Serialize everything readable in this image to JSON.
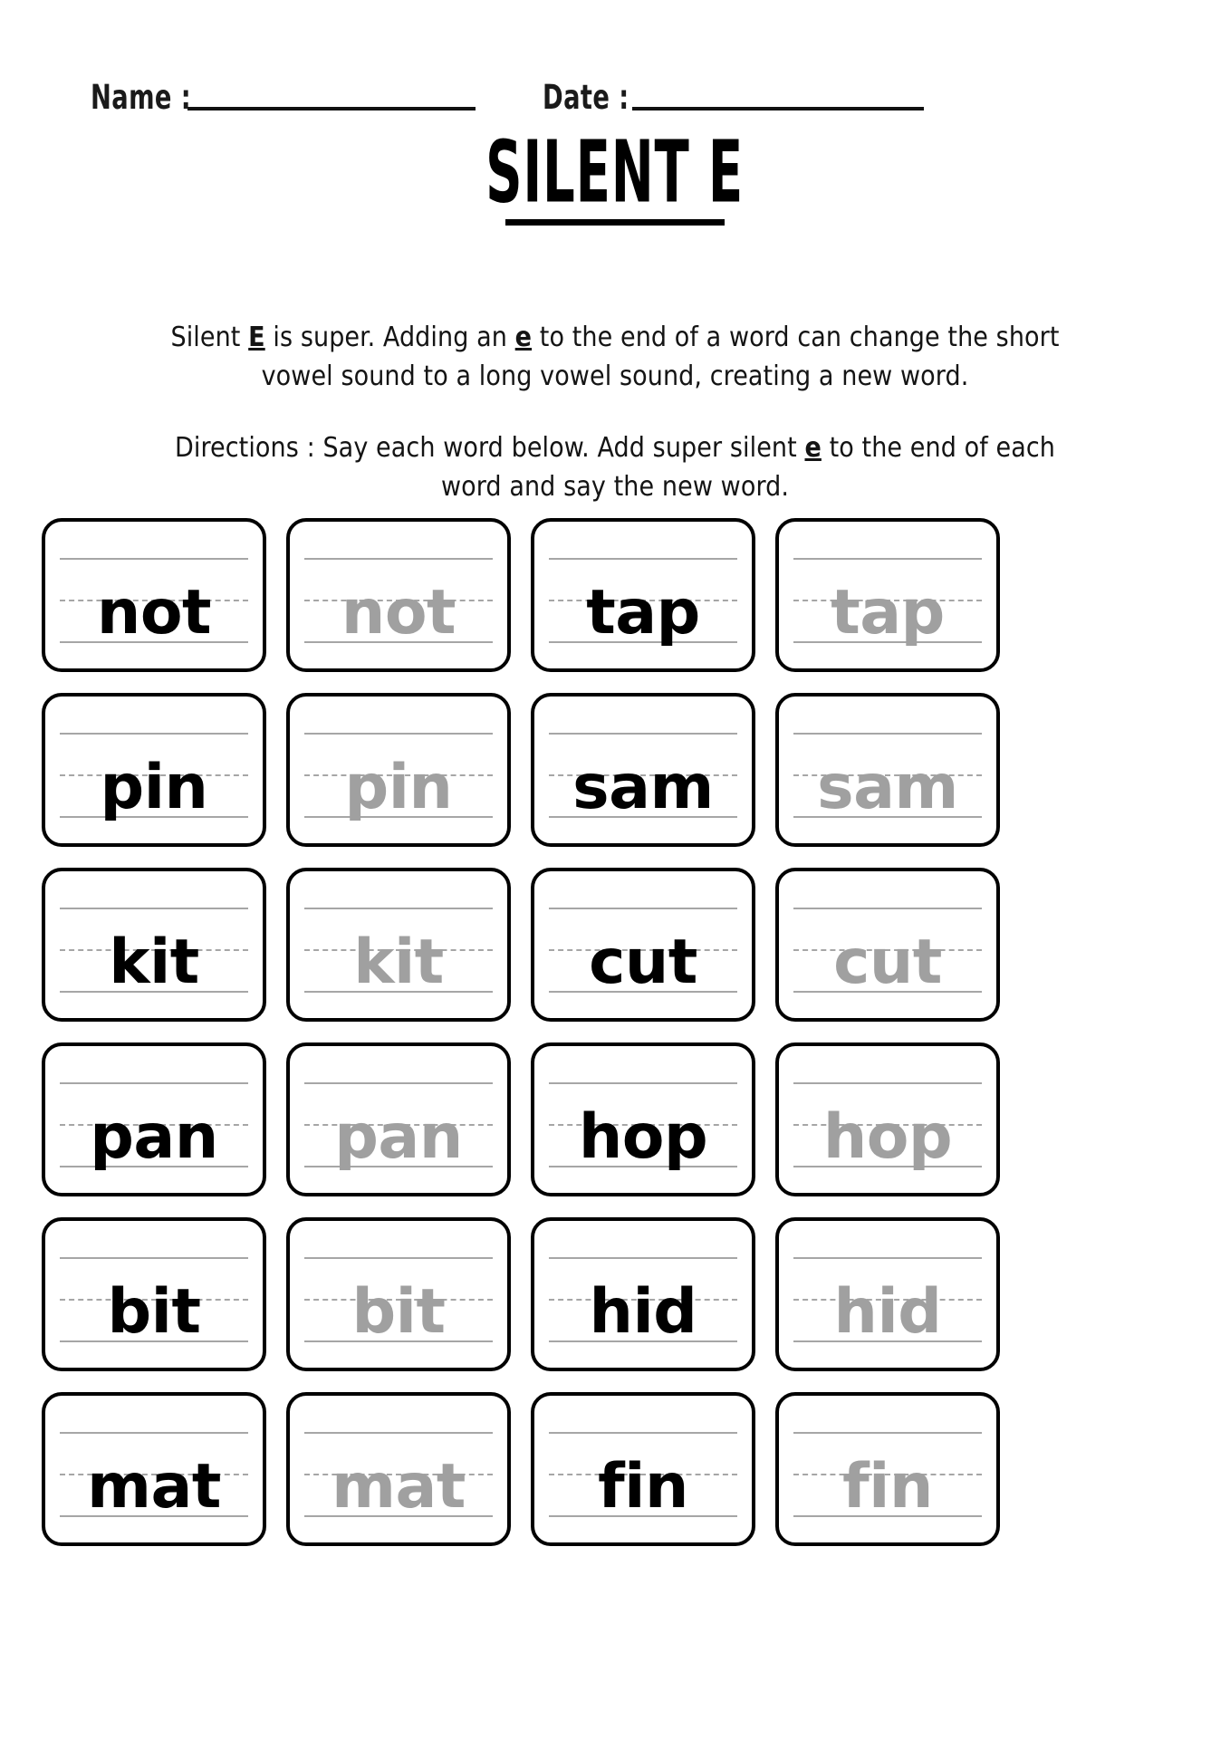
{
  "header": {
    "name_label": "Name :",
    "date_label": "Date :",
    "name_value": "",
    "date_value": ""
  },
  "title": "SILENT E",
  "intro": {
    "part1": "Silent ",
    "bold1": "E",
    "part2": " is super. Adding an ",
    "bold2": "e",
    "part3": " to the end of a word can change the short vowel sound to a long vowel sound, creating a new word."
  },
  "directions": {
    "part1": "Directions : Say each word below. Add super silent ",
    "bold1": "e",
    "part2": " to the end of each word and say the new word."
  },
  "colors": {
    "ink": "#000000",
    "trace": "#a0a0a0",
    "rule": "#a6a6a6",
    "border": "#000000",
    "page": "#ffffff"
  },
  "grid": {
    "columns": 4,
    "rows": 6,
    "cards": [
      {
        "word": "not",
        "style": "solid"
      },
      {
        "word": "not",
        "style": "trace"
      },
      {
        "word": "tap",
        "style": "solid"
      },
      {
        "word": "tap",
        "style": "trace"
      },
      {
        "word": "pin",
        "style": "solid"
      },
      {
        "word": "pin",
        "style": "trace"
      },
      {
        "word": "sam",
        "style": "solid"
      },
      {
        "word": "sam",
        "style": "trace"
      },
      {
        "word": "kit",
        "style": "solid"
      },
      {
        "word": "kit",
        "style": "trace"
      },
      {
        "word": "cut",
        "style": "solid"
      },
      {
        "word": "cut",
        "style": "trace"
      },
      {
        "word": "pan",
        "style": "solid"
      },
      {
        "word": "pan",
        "style": "trace"
      },
      {
        "word": "hop",
        "style": "solid"
      },
      {
        "word": "hop",
        "style": "trace"
      },
      {
        "word": "bit",
        "style": "solid"
      },
      {
        "word": "bit",
        "style": "trace"
      },
      {
        "word": "hid",
        "style": "solid"
      },
      {
        "word": "hid",
        "style": "trace"
      },
      {
        "word": "mat",
        "style": "solid"
      },
      {
        "word": "mat",
        "style": "trace"
      },
      {
        "word": "fin",
        "style": "solid"
      },
      {
        "word": "fin",
        "style": "trace"
      }
    ]
  }
}
